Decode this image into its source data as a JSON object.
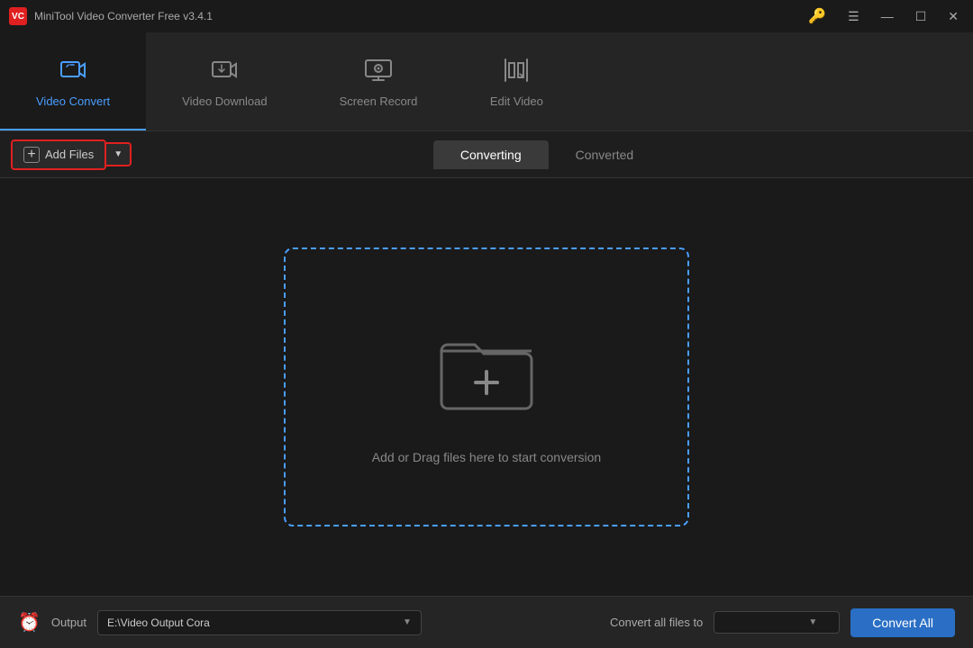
{
  "app": {
    "title": "MiniTool Video Converter Free v3.4.1",
    "logo_text": "VC"
  },
  "titlebar": {
    "key_icon": "🔑",
    "menu_icon": "☰",
    "minimize_icon": "—",
    "maximize_icon": "☐",
    "close_icon": "✕"
  },
  "nav": {
    "items": [
      {
        "id": "video-convert",
        "label": "Video Convert",
        "active": true
      },
      {
        "id": "video-download",
        "label": "Video Download",
        "active": false
      },
      {
        "id": "screen-record",
        "label": "Screen Record",
        "active": false
      },
      {
        "id": "edit-video",
        "label": "Edit Video",
        "active": false
      }
    ]
  },
  "toolbar": {
    "add_files_label": "Add Files",
    "tabs": [
      {
        "id": "converting",
        "label": "Converting",
        "active": true
      },
      {
        "id": "converted",
        "label": "Converted",
        "active": false
      }
    ]
  },
  "dropzone": {
    "label": "Add or Drag files here to start conversion"
  },
  "bottombar": {
    "output_label": "Output",
    "output_path": "E:\\Video Output Cora",
    "convert_all_label": "Convert all files to",
    "convert_all_btn": "Convert All"
  }
}
